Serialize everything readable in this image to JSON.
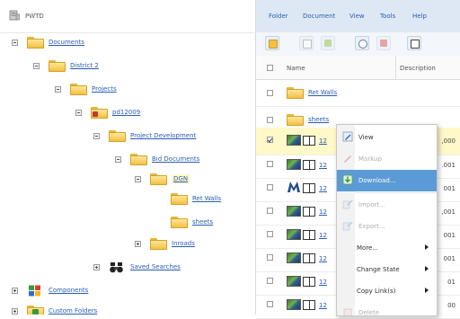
{
  "tree": {
    "server_label": "PWTD",
    "nodes": [
      {
        "label": "Documents"
      },
      {
        "label": "District 2"
      },
      {
        "label": "Projects"
      },
      {
        "label": "pd12009"
      },
      {
        "label": "Project Development"
      },
      {
        "label": "Bid Documents"
      },
      {
        "label": "DGN"
      },
      {
        "label": "Ret Walls"
      },
      {
        "label": "sheets"
      },
      {
        "label": "Inroads"
      },
      {
        "label": "Saved Searches"
      },
      {
        "label": "Components"
      },
      {
        "label": "Custom Folders"
      }
    ]
  },
  "menubar": {
    "items": [
      "Folder",
      "Document",
      "View",
      "Tools",
      "Help"
    ]
  },
  "table": {
    "columns": [
      "Name",
      "Description"
    ],
    "rows": [
      {
        "name": "Ret Walls",
        "desc": ""
      },
      {
        "name": "sheets",
        "desc": ""
      },
      {
        "name": "12",
        "desc": ",000"
      },
      {
        "name": "12",
        "desc": ".001"
      },
      {
        "name": "12",
        "desc": "001"
      },
      {
        "name": "12",
        "desc": ",001"
      },
      {
        "name": "12",
        "desc": "001"
      },
      {
        "name": "12",
        "desc": "001"
      },
      {
        "name": "12",
        "desc": "01"
      },
      {
        "name": "12",
        "desc": "00"
      }
    ]
  },
  "context_menu": {
    "items": [
      {
        "label": "View"
      },
      {
        "label": "Markup"
      },
      {
        "label": "Download..."
      },
      {
        "label": "Import..."
      },
      {
        "label": "Export..."
      },
      {
        "label": "More..."
      },
      {
        "label": "Change State"
      },
      {
        "label": "Copy Link(s)"
      },
      {
        "label": "Delete"
      }
    ]
  },
  "colors": {
    "link": "#2a5db0",
    "menubar_bg": "#dde8f4",
    "highlight_row": "#fff8c8",
    "menu_active": "#5b9bd5",
    "folder": "#f3c142"
  },
  "icons": {
    "server": "server-icon",
    "folder": "folder-icon",
    "binoculars": "binoculars-icon",
    "components": "components-icon",
    "document": "document-icon",
    "book": "book-icon"
  }
}
